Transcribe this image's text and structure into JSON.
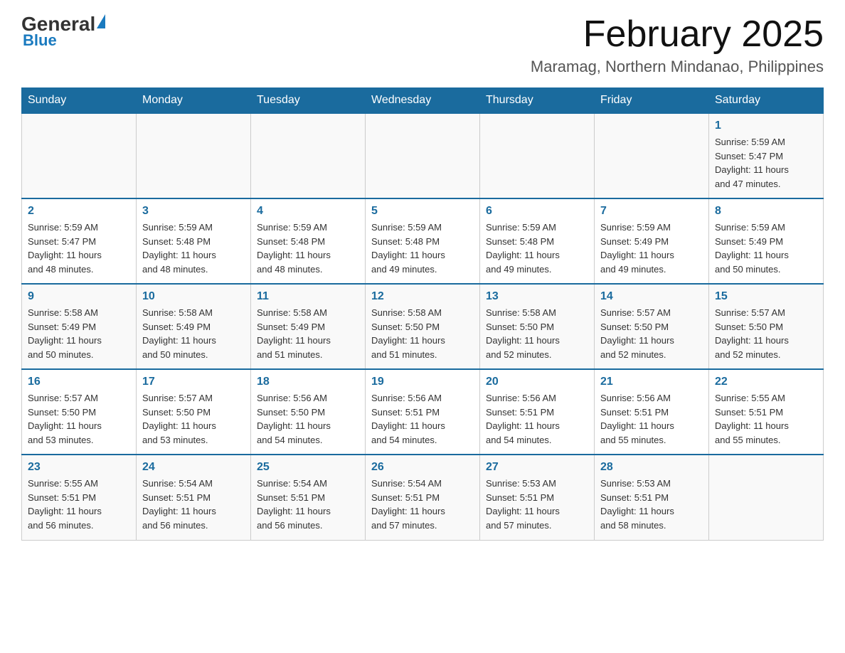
{
  "logo": {
    "general": "General",
    "blue": "Blue"
  },
  "title": "February 2025",
  "subtitle": "Maramag, Northern Mindanao, Philippines",
  "days_of_week": [
    "Sunday",
    "Monday",
    "Tuesday",
    "Wednesday",
    "Thursday",
    "Friday",
    "Saturday"
  ],
  "weeks": [
    [
      {
        "day": "",
        "info": ""
      },
      {
        "day": "",
        "info": ""
      },
      {
        "day": "",
        "info": ""
      },
      {
        "day": "",
        "info": ""
      },
      {
        "day": "",
        "info": ""
      },
      {
        "day": "",
        "info": ""
      },
      {
        "day": "1",
        "info": "Sunrise: 5:59 AM\nSunset: 5:47 PM\nDaylight: 11 hours\nand 47 minutes."
      }
    ],
    [
      {
        "day": "2",
        "info": "Sunrise: 5:59 AM\nSunset: 5:47 PM\nDaylight: 11 hours\nand 48 minutes."
      },
      {
        "day": "3",
        "info": "Sunrise: 5:59 AM\nSunset: 5:48 PM\nDaylight: 11 hours\nand 48 minutes."
      },
      {
        "day": "4",
        "info": "Sunrise: 5:59 AM\nSunset: 5:48 PM\nDaylight: 11 hours\nand 48 minutes."
      },
      {
        "day": "5",
        "info": "Sunrise: 5:59 AM\nSunset: 5:48 PM\nDaylight: 11 hours\nand 49 minutes."
      },
      {
        "day": "6",
        "info": "Sunrise: 5:59 AM\nSunset: 5:48 PM\nDaylight: 11 hours\nand 49 minutes."
      },
      {
        "day": "7",
        "info": "Sunrise: 5:59 AM\nSunset: 5:49 PM\nDaylight: 11 hours\nand 49 minutes."
      },
      {
        "day": "8",
        "info": "Sunrise: 5:59 AM\nSunset: 5:49 PM\nDaylight: 11 hours\nand 50 minutes."
      }
    ],
    [
      {
        "day": "9",
        "info": "Sunrise: 5:58 AM\nSunset: 5:49 PM\nDaylight: 11 hours\nand 50 minutes."
      },
      {
        "day": "10",
        "info": "Sunrise: 5:58 AM\nSunset: 5:49 PM\nDaylight: 11 hours\nand 50 minutes."
      },
      {
        "day": "11",
        "info": "Sunrise: 5:58 AM\nSunset: 5:49 PM\nDaylight: 11 hours\nand 51 minutes."
      },
      {
        "day": "12",
        "info": "Sunrise: 5:58 AM\nSunset: 5:50 PM\nDaylight: 11 hours\nand 51 minutes."
      },
      {
        "day": "13",
        "info": "Sunrise: 5:58 AM\nSunset: 5:50 PM\nDaylight: 11 hours\nand 52 minutes."
      },
      {
        "day": "14",
        "info": "Sunrise: 5:57 AM\nSunset: 5:50 PM\nDaylight: 11 hours\nand 52 minutes."
      },
      {
        "day": "15",
        "info": "Sunrise: 5:57 AM\nSunset: 5:50 PM\nDaylight: 11 hours\nand 52 minutes."
      }
    ],
    [
      {
        "day": "16",
        "info": "Sunrise: 5:57 AM\nSunset: 5:50 PM\nDaylight: 11 hours\nand 53 minutes."
      },
      {
        "day": "17",
        "info": "Sunrise: 5:57 AM\nSunset: 5:50 PM\nDaylight: 11 hours\nand 53 minutes."
      },
      {
        "day": "18",
        "info": "Sunrise: 5:56 AM\nSunset: 5:50 PM\nDaylight: 11 hours\nand 54 minutes."
      },
      {
        "day": "19",
        "info": "Sunrise: 5:56 AM\nSunset: 5:51 PM\nDaylight: 11 hours\nand 54 minutes."
      },
      {
        "day": "20",
        "info": "Sunrise: 5:56 AM\nSunset: 5:51 PM\nDaylight: 11 hours\nand 54 minutes."
      },
      {
        "day": "21",
        "info": "Sunrise: 5:56 AM\nSunset: 5:51 PM\nDaylight: 11 hours\nand 55 minutes."
      },
      {
        "day": "22",
        "info": "Sunrise: 5:55 AM\nSunset: 5:51 PM\nDaylight: 11 hours\nand 55 minutes."
      }
    ],
    [
      {
        "day": "23",
        "info": "Sunrise: 5:55 AM\nSunset: 5:51 PM\nDaylight: 11 hours\nand 56 minutes."
      },
      {
        "day": "24",
        "info": "Sunrise: 5:54 AM\nSunset: 5:51 PM\nDaylight: 11 hours\nand 56 minutes."
      },
      {
        "day": "25",
        "info": "Sunrise: 5:54 AM\nSunset: 5:51 PM\nDaylight: 11 hours\nand 56 minutes."
      },
      {
        "day": "26",
        "info": "Sunrise: 5:54 AM\nSunset: 5:51 PM\nDaylight: 11 hours\nand 57 minutes."
      },
      {
        "day": "27",
        "info": "Sunrise: 5:53 AM\nSunset: 5:51 PM\nDaylight: 11 hours\nand 57 minutes."
      },
      {
        "day": "28",
        "info": "Sunrise: 5:53 AM\nSunset: 5:51 PM\nDaylight: 11 hours\nand 58 minutes."
      },
      {
        "day": "",
        "info": ""
      }
    ]
  ]
}
